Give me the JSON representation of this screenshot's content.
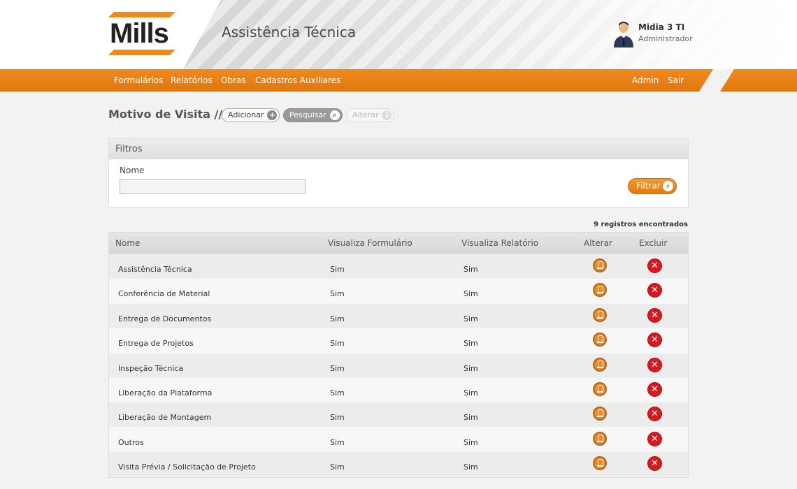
{
  "header": {
    "logo_text": "Mills",
    "app_title": "Assistência Técnica",
    "user_name": "Midia 3 TI",
    "user_role": "Administrador"
  },
  "nav": {
    "left": [
      "Formulários",
      "Relatórios",
      "Obras",
      "Cadastros Auxiliares"
    ],
    "right": [
      "Admin",
      "Sair"
    ]
  },
  "page": {
    "title": "Motivo de Visita //",
    "actions": {
      "add": "Adicionar",
      "search": "Pesquisar",
      "edit": "Alterar"
    }
  },
  "filters": {
    "header": "Filtros",
    "name_label": "Nome",
    "name_value": "",
    "filter_button": "Filtrar"
  },
  "results_count": "9 registros encontrados",
  "table": {
    "columns": [
      "Nome",
      "Visualiza Formulário",
      "Visualiza Relatório",
      "Alterar",
      "Excluir"
    ],
    "rows": [
      {
        "nome": "Assistência Técnica",
        "form": "Sim",
        "rel": "Sim"
      },
      {
        "nome": "Conferência de Material",
        "form": "Sim",
        "rel": "Sim"
      },
      {
        "nome": "Entrega de Documentos",
        "form": "Sim",
        "rel": "Sim"
      },
      {
        "nome": "Entrega de Projetos",
        "form": "Sim",
        "rel": "Sim"
      },
      {
        "nome": "Inspeção Técnica",
        "form": "Sim",
        "rel": "Sim"
      },
      {
        "nome": "Liberação da Plataforma",
        "form": "Sim",
        "rel": "Sim"
      },
      {
        "nome": "Liberação de Montagem",
        "form": "Sim",
        "rel": "Sim"
      },
      {
        "nome": "Outros",
        "form": "Sim",
        "rel": "Sim"
      },
      {
        "nome": "Visita Prévia / Solicitação de Projeto",
        "form": "Sim",
        "rel": "Sim"
      }
    ]
  },
  "icons": {
    "add": "plus-circle-icon",
    "search": "magnifier-icon",
    "edit_action": "arrow-down-circle-icon",
    "row_edit": "pen-icon",
    "row_delete": "x-circle-icon"
  },
  "colors": {
    "brand_orange": "#f08a1c",
    "delete_red": "#d71920"
  }
}
